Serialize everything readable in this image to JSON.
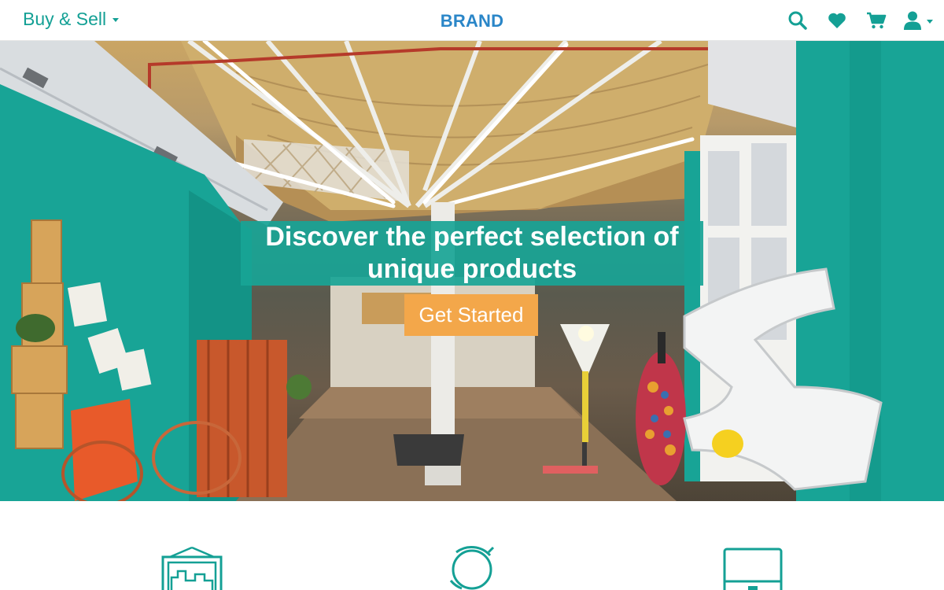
{
  "header": {
    "menu_label": "Buy & Sell",
    "brand": "BRAND",
    "icons": [
      "search-icon",
      "heart-icon",
      "cart-icon",
      "user-icon"
    ]
  },
  "hero": {
    "title": "Discover the perfect selection of unique products",
    "cta_label": "Get Started"
  },
  "features": {
    "icons": [
      "framed-picture-icon",
      "globe-icon",
      "cabinet-icon"
    ]
  },
  "colors": {
    "accent": "#14a095",
    "brand": "#2a86c8",
    "cta": "#f3a74a",
    "wall": "#18a496"
  }
}
